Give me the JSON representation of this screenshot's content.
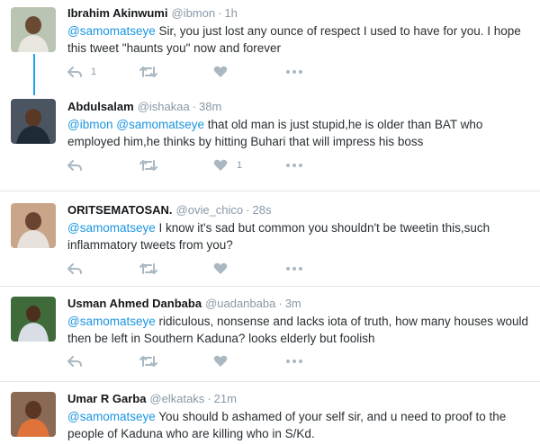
{
  "colors": {
    "mention": "#1b95e0",
    "thread_line": "#1da1f2",
    "muted": "#8899a6",
    "icon": "#aab8c2"
  },
  "tweets": [
    {
      "name": "Ibrahim Akinwumi",
      "handle": "@ibmon",
      "time": "1h",
      "text_segments": [
        {
          "mention": "@samomatseye"
        },
        {
          "plain": " Sir, you just lost any ounce of respect I used to have for you. I hope this tweet \"haunts you\" now and forever"
        }
      ],
      "reply_count": "1",
      "retweet_count": "",
      "like_count": ""
    },
    {
      "name": "Abdulsalam",
      "handle": "@ishakaa",
      "time": "38m",
      "text_segments": [
        {
          "mention": "@ibmon"
        },
        {
          "plain": " "
        },
        {
          "mention": "@samomatseye"
        },
        {
          "plain": " that old man is just stupid,he is older than BAT who employed him,he thinks by hitting Buhari that will impress his boss"
        }
      ],
      "reply_count": "",
      "retweet_count": "",
      "like_count": "1"
    },
    {
      "name": "ORITSEMATOSAN.",
      "handle": "@ovie_chico",
      "time": "28s",
      "text_segments": [
        {
          "mention": "@samomatseye"
        },
        {
          "plain": " I know it's sad but common you shouldn't be tweetin this,such inflammatory tweets from you?"
        }
      ],
      "reply_count": "",
      "retweet_count": "",
      "like_count": ""
    },
    {
      "name": "Usman Ahmed Danbaba",
      "handle": "@uadanbaba",
      "time": "3m",
      "text_segments": [
        {
          "mention": "@samomatseye"
        },
        {
          "plain": " ridiculous, nonsense and lacks iota of truth, how many houses would then be left in Southern Kaduna? looks elderly but foolish"
        }
      ],
      "reply_count": "",
      "retweet_count": "",
      "like_count": ""
    },
    {
      "name": "Umar R Garba",
      "handle": "@elkataks",
      "time": "21m",
      "text_segments": [
        {
          "mention": "@samomatseye"
        },
        {
          "plain": " You should b ashamed of your self sir, and u need to proof to the people of Kaduna who are killing who in S/Kd."
        }
      ],
      "reply_count": "",
      "retweet_count": "",
      "like_count": ""
    }
  ]
}
